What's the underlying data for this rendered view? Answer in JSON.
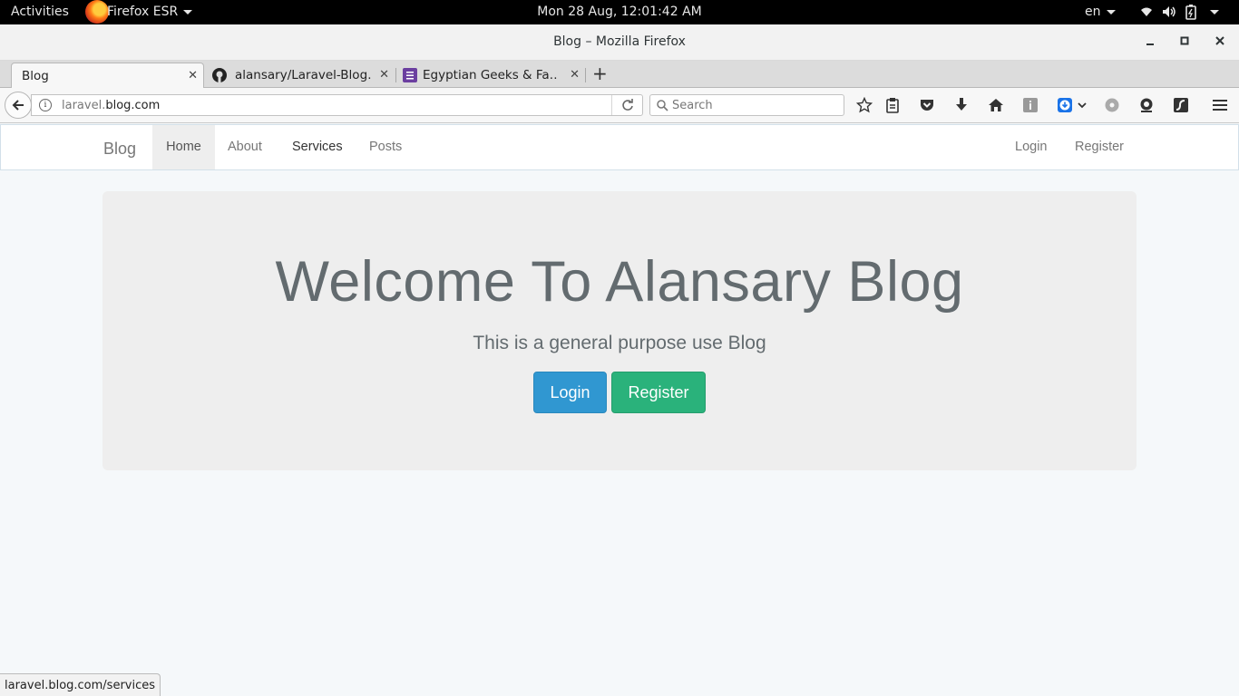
{
  "system_bar": {
    "activities": "Activities",
    "app_name": "Firefox ESR",
    "clock": "Mon 28 Aug, 12:01:42 AM",
    "language": "en"
  },
  "window": {
    "title": "Blog – Mozilla Firefox"
  },
  "tabs": [
    {
      "label": "Blog"
    },
    {
      "label": "alansary/Laravel-Blog…"
    },
    {
      "label": "Egyptian Geeks & Fa…"
    }
  ],
  "toolbar": {
    "url_host_prefix": "laravel.",
    "url_host_domain": "blog.com",
    "search_placeholder": "Search"
  },
  "site": {
    "brand": "Blog",
    "nav_left": [
      "Home",
      "About",
      "Services",
      "Posts"
    ],
    "nav_right": [
      "Login",
      "Register"
    ],
    "hero": {
      "heading": "Welcome To Alansary Blog",
      "subheading": "This is a general purpose use Blog",
      "login_button": "Login",
      "register_button": "Register"
    }
  },
  "status_url": "laravel.blog.com/services",
  "colors": {
    "primary": "#3097d1",
    "success": "#2ab27b",
    "page_bg": "#f5f8fa",
    "jumbotron_bg": "#eeeeee"
  }
}
